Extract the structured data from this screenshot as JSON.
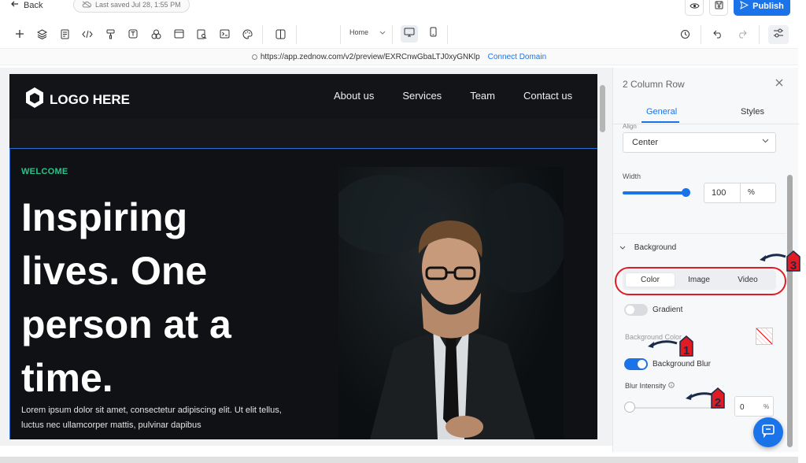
{
  "topbar": {
    "back_label": "Back",
    "last_saved": "Last saved Jul 28, 1:55 PM",
    "publish_label": "Publish"
  },
  "toolbar": {
    "page_selector": "Home"
  },
  "urlbar": {
    "url": "https://app.zednow.com/v2/preview/EXRCnwGbaLTJ0xyGNKlp",
    "connect_label": "Connect Domain"
  },
  "preview": {
    "logo_text": "LOGO HERE",
    "nav": [
      "About us",
      "Services",
      "Team",
      "Contact us"
    ],
    "welcome": "WELCOME",
    "headline": [
      "Inspiring",
      "lives. One",
      "person at a",
      "time."
    ],
    "paragraph": "Lorem ipsum dolor sit amet, consectetur adipiscing elit. Ut elit tellus, luctus nec ullamcorper mattis, pulvinar dapibus"
  },
  "panel": {
    "title": "2 Column Row",
    "tabs": {
      "general": "General",
      "styles": "Styles"
    },
    "align_label": "Align",
    "align_value": "Center",
    "width_label": "Width",
    "width_value": "100",
    "width_unit": "%",
    "width_fraction": 1.0,
    "background_header": "Background",
    "bg_tabs": [
      "Color",
      "Image",
      "Video"
    ],
    "gradient_label": "Gradient",
    "gradient_on": false,
    "bg_color_label": "Background Color",
    "bg_blur_label": "Background Blur",
    "bg_blur_on": true,
    "blur_intensity_label": "Blur Intensity",
    "blur_value": "0",
    "blur_unit": "%"
  },
  "annotations": [
    "1",
    "2",
    "3"
  ],
  "colors": {
    "accent": "#1a73e8",
    "welcome_green": "#27c48a",
    "annotation_red": "#e01b22",
    "preview_bg": "#0f1114"
  }
}
